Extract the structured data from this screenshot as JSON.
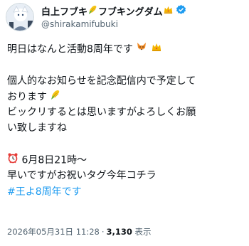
{
  "header": {
    "display_name": "白上フブキ",
    "display_name_suffix": "フブキングダム",
    "handle": "@shirakamifubuki"
  },
  "icons": {
    "avatar": "avatar",
    "name_corn": "corn-emoji",
    "name_crown": "crown-emoji",
    "verified": "verified-badge-icon",
    "fox": "fox-emoji",
    "crown": "crown-emoji",
    "corn": "corn-emoji",
    "alarm": "alarm-clock-emoji"
  },
  "colors": {
    "text": "#0f1419",
    "secondary": "#536471",
    "link": "#1d9bf0",
    "verified": "#1d9bf0"
  },
  "tweet": {
    "line1": "明日はなんと活動8周年です",
    "line2": "個人的なお知らせを記念配信内で予定して",
    "line3": "おります",
    "line4": "ビックリするとは思いますがよろしくお願",
    "line5": "い致しますね",
    "line6": "6月8日21時～",
    "line7": "早いですがお祝いタグ今年コチラ",
    "hashtag": "#王よ8周年です"
  },
  "footer": {
    "timestamp": "2026年05月31日 11:28",
    "separator": "·",
    "view_count": "3,130",
    "view_label": "表示"
  }
}
